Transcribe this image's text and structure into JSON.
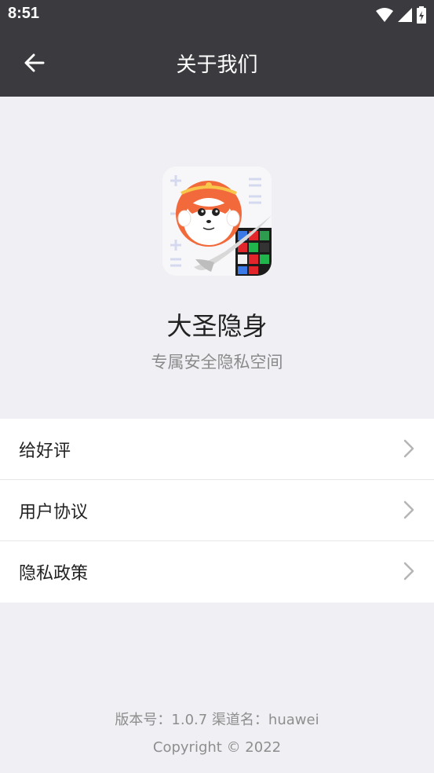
{
  "status_bar": {
    "time": "8:51",
    "icons": [
      "wifi-icon",
      "signal-icon",
      "battery-icon"
    ]
  },
  "toolbar": {
    "back_icon": "arrow-left-icon",
    "title": "关于我们"
  },
  "app": {
    "name": "大圣隐身",
    "slogan": "专属安全隐私空间"
  },
  "menu": {
    "items": [
      {
        "label": "给好评"
      },
      {
        "label": "用户协议"
      },
      {
        "label": "隐私政策"
      }
    ]
  },
  "footer": {
    "version_line": "版本号：1.0.7 渠道名：huawei",
    "copyright": "Copyright © 2022"
  },
  "colors": {
    "header": "#3a3a3f",
    "background": "#f0eff4",
    "monkey_face": "#f26a3c"
  }
}
